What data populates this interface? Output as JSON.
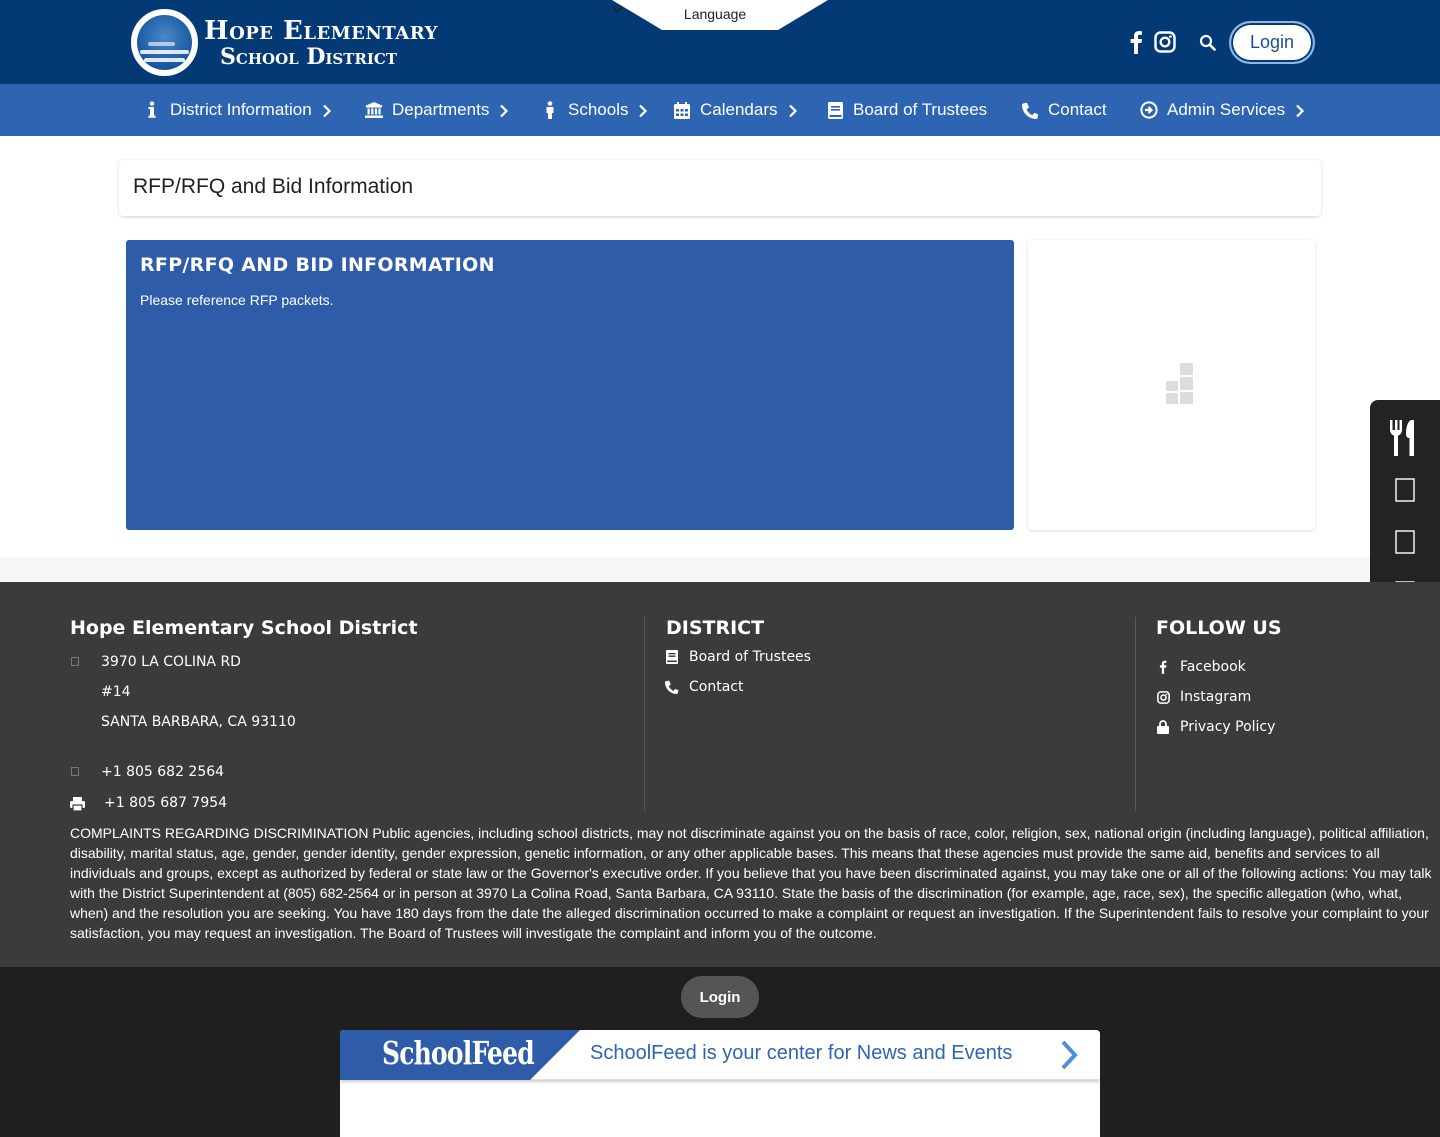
{
  "header": {
    "logo_line1": "Hope Elementary",
    "logo_line2": "School District",
    "language_label": "Language",
    "icons": [
      "facebook-icon",
      "instagram-icon",
      "search-icon"
    ],
    "login_label": "Login",
    "colors": {
      "header_bg": "#033a76",
      "nav_bg": "#2e65b3"
    }
  },
  "nav": {
    "items": [
      {
        "label": "District Information",
        "icon": "info-icon",
        "has_submenu": true
      },
      {
        "label": "Departments",
        "icon": "building-icon",
        "has_submenu": true
      },
      {
        "label": "Schools",
        "icon": "person-icon",
        "has_submenu": true
      },
      {
        "label": "Calendars",
        "icon": "calendar-icon",
        "has_submenu": true
      },
      {
        "label": "Board of Trustees",
        "icon": "book-icon",
        "has_submenu": false
      },
      {
        "label": "Contact",
        "icon": "phone-icon",
        "has_submenu": false
      },
      {
        "label": "Admin Services",
        "icon": "circle-arrow-icon",
        "has_submenu": true
      }
    ]
  },
  "main": {
    "page_title": "RFP/RFQ and Bid Information",
    "card_heading": "RFP/RFQ AND BID INFORMATION",
    "card_body": "Please reference RFP packets.",
    "card_color": "#2e5ca8"
  },
  "side_panel": {
    "items": [
      "utensils-icon",
      "square-icon",
      "square-icon",
      "square-icon",
      "gear-icon"
    ]
  },
  "footer": {
    "org_name": "Hope Elementary School District",
    "address_line1": "3970 LA COLINA RD",
    "address_line2": "#14",
    "address_line3": "SANTA BARBARA, CA 93110",
    "phone": "+1 805 682 2564",
    "fax": "+1 805 687 7954",
    "district_heading": "DISTRICT",
    "district_links": [
      {
        "label": "Board of Trustees",
        "icon": "book-icon"
      },
      {
        "label": "Contact",
        "icon": "phone-icon"
      }
    ],
    "follow_heading": "FOLLOW US",
    "follow_links": [
      {
        "label": "Facebook",
        "icon": "facebook-icon"
      },
      {
        "label": "Instagram",
        "icon": "instagram-icon"
      },
      {
        "label": "Privacy Policy",
        "icon": "lock-icon"
      }
    ],
    "complaint_text": "COMPLAINTS REGARDING DISCRIMINATION Public agencies, including school districts, may not discriminate against you on the basis of race, color, religion, sex, national origin (including language), political affiliation, disability, marital status, age, gender, gender identity, gender expression, genetic information, or any other applicable bases. This means that these agencies must provide the same aid, benefits and services to all individuals and groups, except as authorized by federal or state law or the Governor's executive order. If you believe that you have been discriminated against, you may take one or all of the following actions: You may talk with the District Superintendent at (805) 682-2564 or in person at 3970 La Colina Road, Santa Barbara, CA 93110. State the basis of the discrimination (for example, age, race, sex), the specific allegation (who, what, when) and the resolution you are seeking. You have 180 days from the date the alleged discrimination occurred to make a complaint or request an investigation. If the Superintendent fails to resolve your complaint to your satisfaction, you may request an investigation. The Board of Trustees will investigate the complaint and inform you of the outcome."
  },
  "bottom": {
    "login_label": "Login",
    "schoolfeed_logo": "SchoolFeed",
    "schoolfeed_text": "SchoolFeed is your center for News and Events"
  }
}
